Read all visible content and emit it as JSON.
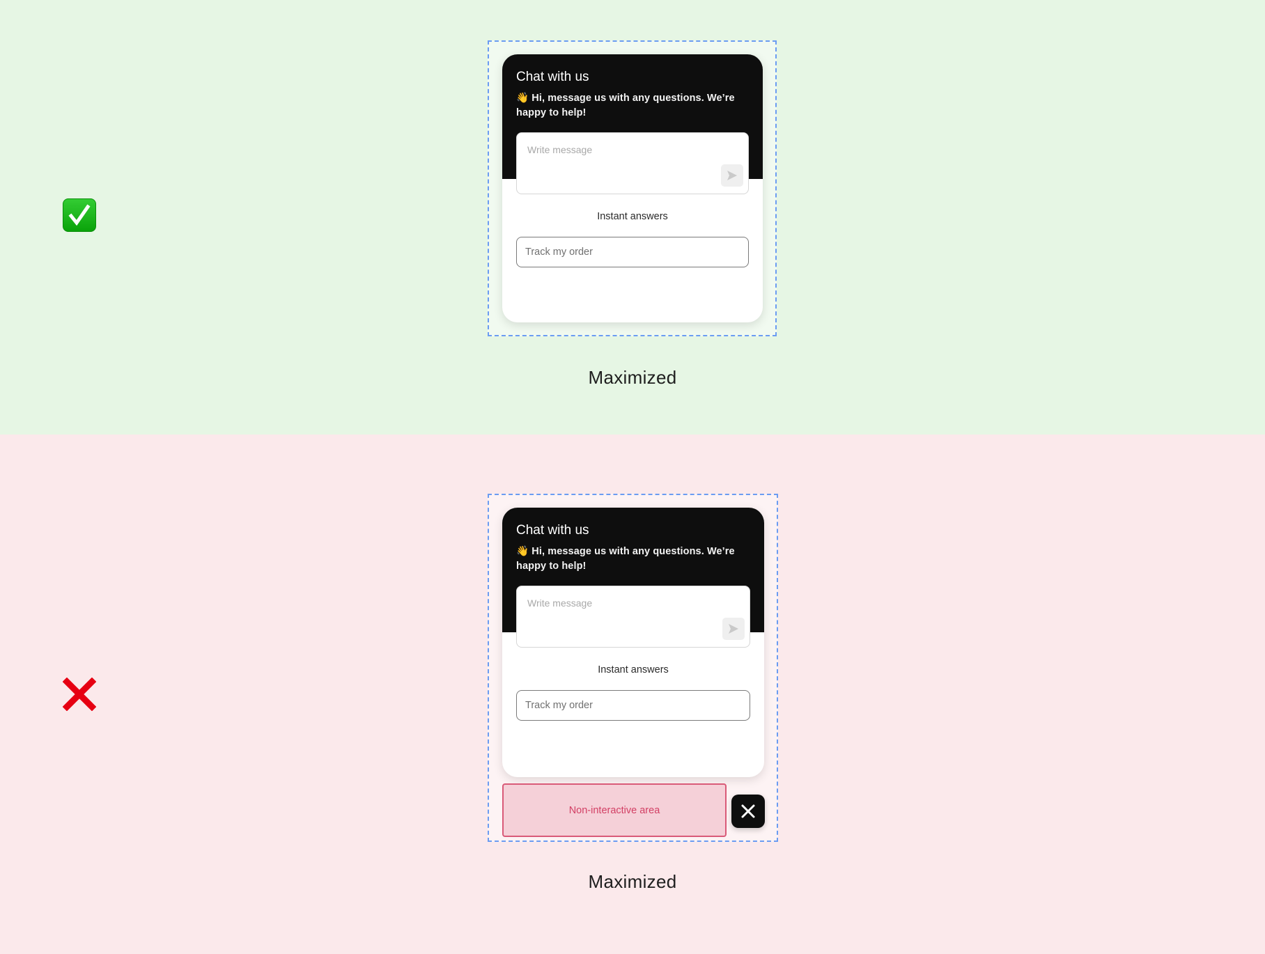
{
  "examples": {
    "good": {
      "status_icon": "check-mark-button-icon",
      "caption": "Maximized",
      "widget": {
        "title": "Chat with us",
        "subtitle": "👋 Hi, message us with any questions. We’re happy to help!",
        "message_placeholder": "Write message",
        "send_icon": "send-icon",
        "instant_answers_label": "Instant answers",
        "quick_reply": "Track my order"
      }
    },
    "bad": {
      "status_icon": "cross-mark-icon",
      "caption": "Maximized",
      "widget": {
        "title": "Chat with us",
        "subtitle": "👋 Hi, message us with any questions. We’re happy to help!",
        "message_placeholder": "Write message",
        "send_icon": "send-icon",
        "instant_answers_label": "Instant answers",
        "quick_reply": "Track my order"
      },
      "non_interactive_label": "Non-interactive area",
      "close_icon": "close-icon"
    }
  },
  "colors": {
    "good_background": "#e6f6e4",
    "bad_background": "#fbe9eb",
    "frame_dash": "#6b9cf2",
    "header": "#0e0e0e",
    "non_interactive_fill": "#f5d0d8",
    "non_interactive_text": "#d23f64",
    "check_green": "#1db31d",
    "cross_red": "#e60012"
  }
}
